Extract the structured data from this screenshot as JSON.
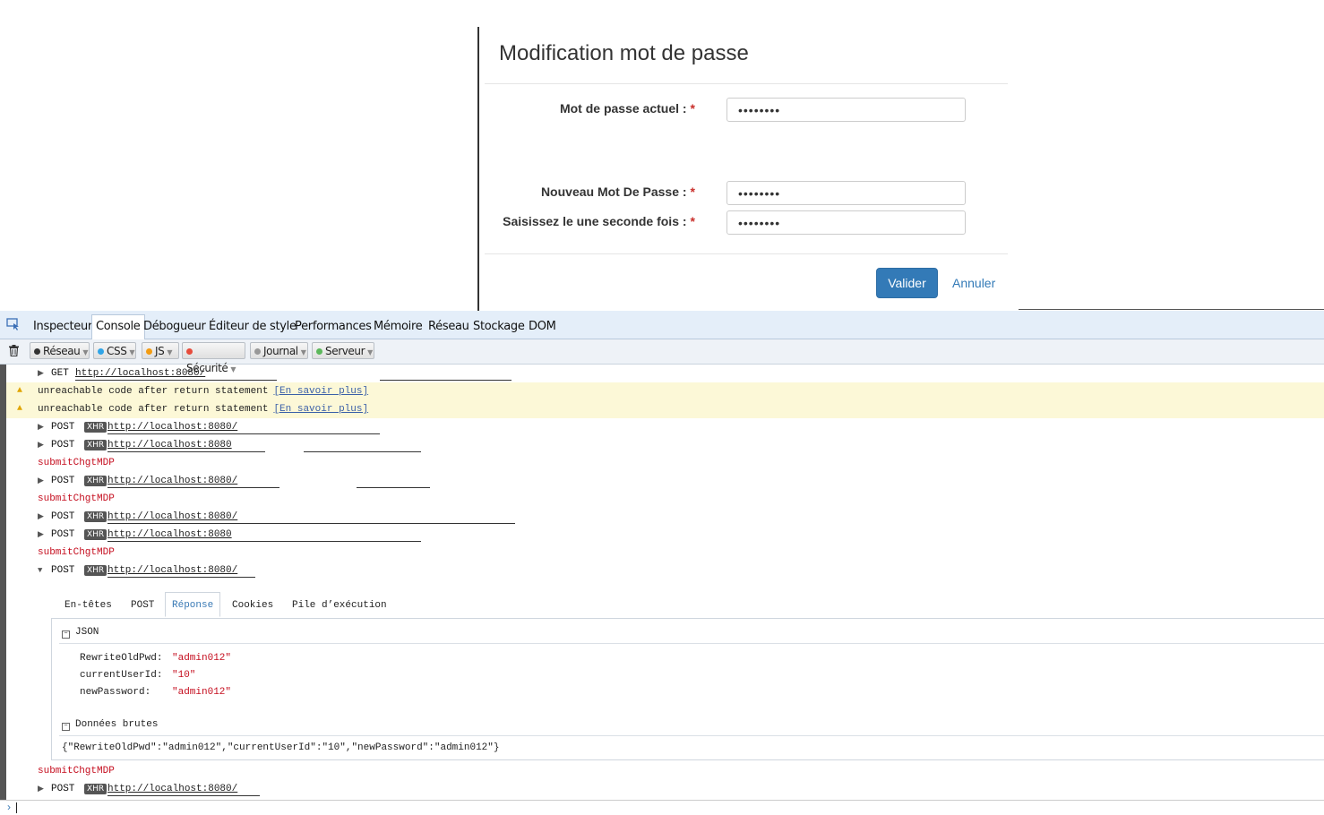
{
  "modal": {
    "title": "Modification mot de passe",
    "fields": [
      {
        "label": "Mot de passe actuel :",
        "required": "*",
        "value": "••••••••"
      },
      {
        "label": "Nouveau Mot De Passe :",
        "required": "*",
        "value": "••••••••"
      },
      {
        "label": "Saisissez le une seconde fois :",
        "required": "*",
        "value": "••••••••"
      }
    ],
    "submit_label": "Valider",
    "cancel_label": "Annuler"
  },
  "devtools": {
    "tabs": [
      "Inspecteur",
      "Console",
      "Débogueur",
      "Éditeur de style",
      "Performances",
      "Mémoire",
      "Réseau",
      "Stockage",
      "DOM"
    ],
    "active_tab": "Console",
    "filters": [
      {
        "label": "Réseau",
        "color": "#333333"
      },
      {
        "label": "CSS",
        "color": "#2fa4e7"
      },
      {
        "label": "JS",
        "color": "#f39c12"
      },
      {
        "label": "Sécurité",
        "color": "#e74c3c"
      },
      {
        "label": "Journal",
        "color": "#999999"
      },
      {
        "label": "Serveur",
        "color": "#5cb85c"
      }
    ]
  },
  "console": {
    "rows": [
      {
        "type": "req",
        "method": "GET",
        "url": "http://localhost:8080/"
      },
      {
        "type": "warn",
        "message": "unreachable code after return statement",
        "link": "[En savoir plus]"
      },
      {
        "type": "warn",
        "message": "unreachable code after return statement",
        "link": "[En savoir plus]"
      },
      {
        "type": "req",
        "method": "POST",
        "xhr": "XHR",
        "url": "http://localhost:8080/"
      },
      {
        "type": "req",
        "method": "POST",
        "xhr": "XHR",
        "url": "http://localhost:8080"
      },
      {
        "type": "log",
        "message": "submitChgtMDP"
      },
      {
        "type": "req",
        "method": "POST",
        "xhr": "XHR",
        "url": "http://localhost:8080/"
      },
      {
        "type": "log",
        "message": "submitChgtMDP"
      },
      {
        "type": "req",
        "method": "POST",
        "xhr": "XHR",
        "url": "http://localhost:8080/"
      },
      {
        "type": "req",
        "method": "POST",
        "xhr": "XHR",
        "url": "http://localhost:8080"
      },
      {
        "type": "log",
        "message": "submitChgtMDP"
      },
      {
        "type": "req",
        "method": "POST",
        "xhr": "XHR",
        "url": "http://localhost:8080/"
      }
    ],
    "detail": {
      "tabs": [
        "En-têtes",
        "POST",
        "Réponse",
        "Cookies",
        "Pile d’exécution"
      ],
      "active_tab": "Réponse",
      "json_header": "JSON",
      "json": [
        {
          "key": "RewriteOldPwd:",
          "value": "\"admin012\""
        },
        {
          "key": "currentUserId:",
          "value": "\"10\""
        },
        {
          "key": "newPassword:",
          "value": "\"admin012\""
        }
      ],
      "raw_header": "Données brutes",
      "raw": "{\"RewriteOldPwd\":\"admin012\",\"currentUserId\":\"10\",\"newPassword\":\"admin012\"}"
    },
    "after": [
      {
        "type": "log",
        "message": "submitChgtMDP"
      },
      {
        "type": "req",
        "method": "POST",
        "xhr": "XHR",
        "url": "http://localhost:8080/"
      }
    ],
    "prompt": "›"
  }
}
